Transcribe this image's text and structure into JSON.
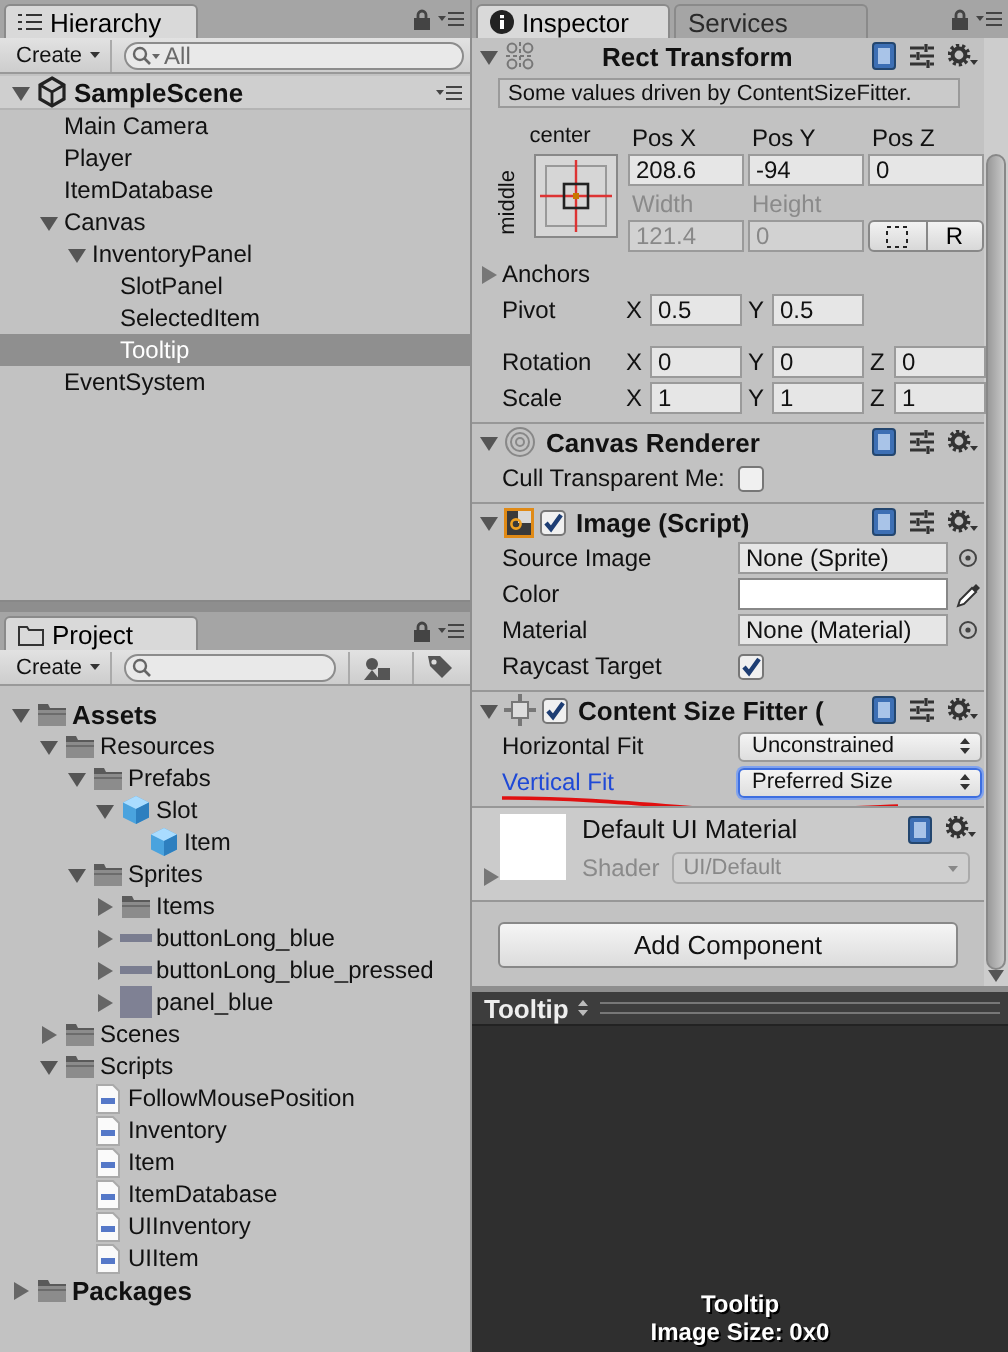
{
  "hierarchy": {
    "tabs": [
      {
        "label": "Hierarchy"
      }
    ],
    "create": "Create",
    "search": {
      "placeholder": "All"
    },
    "scene": {
      "name": "SampleScene",
      "expanded": true,
      "children": [
        {
          "label": "Main Camera",
          "selected": false
        },
        {
          "label": "Player",
          "selected": false
        },
        {
          "label": "ItemDatabase",
          "selected": false
        },
        {
          "label": "Canvas",
          "selected": false,
          "expanded": true,
          "children": [
            {
              "label": "InventoryPanel",
              "selected": false,
              "expanded": true,
              "children": [
                {
                  "label": "SlotPanel",
                  "selected": false
                },
                {
                  "label": "SelectedItem",
                  "selected": false
                },
                {
                  "label": "Tooltip",
                  "selected": true
                }
              ]
            }
          ]
        },
        {
          "label": "EventSystem",
          "selected": false
        }
      ]
    }
  },
  "project": {
    "tabs": [
      {
        "label": "Project"
      }
    ],
    "create": "Create",
    "tree": [
      {
        "label": "Assets",
        "kind": "folder",
        "expanded": true,
        "children": [
          {
            "label": "Resources",
            "kind": "folder",
            "expanded": true,
            "children": [
              {
                "label": "Prefabs",
                "kind": "folder",
                "expanded": true,
                "children": [
                  {
                    "label": "Slot",
                    "kind": "prefab",
                    "expanded": true,
                    "children": [
                      {
                        "label": "Item",
                        "kind": "prefab"
                      }
                    ]
                  }
                ]
              },
              {
                "label": "Sprites",
                "kind": "folder",
                "expanded": true,
                "children": [
                  {
                    "label": "Items",
                    "kind": "folder",
                    "expanded": false
                  },
                  {
                    "label": "buttonLong_blue",
                    "kind": "sprite_bar",
                    "expanded": false
                  },
                  {
                    "label": "buttonLong_blue_pressed",
                    "kind": "sprite_bar",
                    "expanded": false
                  },
                  {
                    "label": "panel_blue",
                    "kind": "sprite_square",
                    "expanded": false
                  }
                ]
              }
            ]
          },
          {
            "label": "Scenes",
            "kind": "folder",
            "expanded": false
          },
          {
            "label": "Scripts",
            "kind": "folder",
            "expanded": true,
            "children": [
              {
                "label": "FollowMousePosition",
                "kind": "script"
              },
              {
                "label": "Inventory",
                "kind": "script"
              },
              {
                "label": "Item",
                "kind": "script"
              },
              {
                "label": "ItemDatabase",
                "kind": "script"
              },
              {
                "label": "UIInventory",
                "kind": "script"
              },
              {
                "label": "UIItem",
                "kind": "script"
              }
            ]
          }
        ]
      },
      {
        "label": "Packages",
        "kind": "folder",
        "expanded": false
      }
    ]
  },
  "inspector": {
    "tabs": [
      {
        "label": "Inspector",
        "selected": true
      },
      {
        "label": "Services",
        "selected": false
      }
    ],
    "components": [
      {
        "kind": "rect_transform",
        "title": "Rect Transform",
        "expanded": true,
        "notice": "Some values driven by ContentSizeFitter.",
        "anchor_h": "center",
        "anchor_v": "middle",
        "position": [
          {
            "label": "Pos X",
            "value": "208.6",
            "disabled": false
          },
          {
            "label": "Pos Y",
            "value": "-94",
            "disabled": false
          },
          {
            "label": "Pos Z",
            "value": "0",
            "disabled": false
          }
        ],
        "size": [
          {
            "label": "Width",
            "value": "121.4",
            "disabled": true
          },
          {
            "label": "Height",
            "value": "0",
            "disabled": true
          }
        ],
        "raw_button": "R",
        "anchors": {
          "label": "Anchors",
          "expanded": false
        },
        "vectors": [
          {
            "label": "Pivot",
            "fields": [
              {
                "axis": "X",
                "value": "0.5"
              },
              {
                "axis": "Y",
                "value": "0.5"
              }
            ]
          },
          {
            "label": "Rotation",
            "fields": [
              {
                "axis": "X",
                "value": "0"
              },
              {
                "axis": "Y",
                "value": "0"
              },
              {
                "axis": "Z",
                "value": "0"
              }
            ]
          },
          {
            "label": "Scale",
            "fields": [
              {
                "axis": "X",
                "value": "1"
              },
              {
                "axis": "Y",
                "value": "1"
              },
              {
                "axis": "Z",
                "value": "1"
              }
            ]
          }
        ]
      },
      {
        "kind": "canvas_renderer",
        "title": "Canvas Renderer",
        "expanded": true,
        "rows": [
          {
            "kind": "checkbox",
            "label": "Cull Transparent Me:",
            "checked": false
          }
        ]
      },
      {
        "kind": "image_script",
        "title": "Image (Script)",
        "expanded": true,
        "enabled": true,
        "rows": [
          {
            "kind": "object",
            "label": "Source Image",
            "value": "None (Sprite)"
          },
          {
            "kind": "color",
            "label": "Color",
            "color": "#ffffff"
          },
          {
            "kind": "object",
            "label": "Material",
            "value": "None (Material)"
          },
          {
            "kind": "checkbox",
            "label": "Raycast Target",
            "checked": true
          }
        ]
      },
      {
        "kind": "size_fitter",
        "title": "Content Size Fitter (",
        "expanded": true,
        "enabled": true,
        "rows": [
          {
            "kind": "dropdown",
            "label": "Horizontal Fit",
            "value": "Unconstrained",
            "focused": false,
            "underlined": false
          },
          {
            "kind": "dropdown",
            "label": "Vertical Fit",
            "value": "Preferred Size",
            "focused": true,
            "underlined": true
          }
        ]
      },
      {
        "kind": "material",
        "title": "Default UI Material",
        "expanded": false,
        "shader_label": "Shader",
        "shader": "UI/Default"
      }
    ],
    "add_component": "Add Component"
  },
  "preview": {
    "title": "Tooltip",
    "name": "Tooltip",
    "image_size": "Image Size: 0x0"
  }
}
